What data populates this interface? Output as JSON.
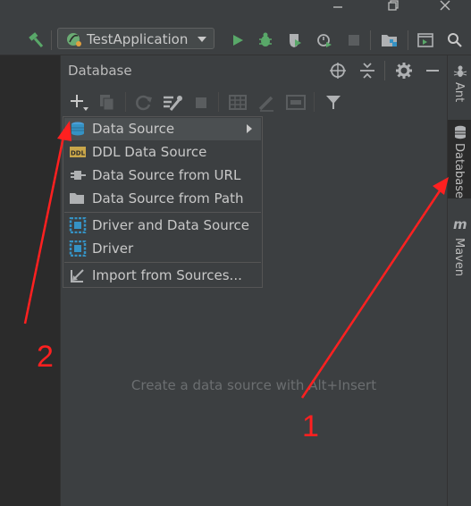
{
  "toolbar": {
    "run_config": "TestApplication",
    "icons": [
      "build-hammer-icon",
      "run-icon",
      "debug-icon",
      "coverage-icon",
      "profile-icon",
      "stop-icon",
      "project-structure-icon",
      "terminal-icon",
      "search-icon"
    ]
  },
  "db_panel": {
    "title": "Database",
    "empty_hint": "Create a data source with Alt+Insert"
  },
  "menu": {
    "items": [
      {
        "label": "Data Source",
        "icon": "database-icon",
        "has_submenu": true
      },
      {
        "label": "DDL Data Source",
        "icon": "ddl-icon"
      },
      {
        "label": "Data Source from URL",
        "icon": "url-plug-icon"
      },
      {
        "label": "Data Source from Path",
        "icon": "folder-icon"
      },
      {
        "label": "Driver and Data Source",
        "icon": "driver-icon"
      },
      {
        "label": "Driver",
        "icon": "driver-icon"
      },
      {
        "label": "Import from Sources...",
        "icon": "import-icon"
      }
    ]
  },
  "right_strip": {
    "ant": "Ant",
    "database": "Database",
    "maven": "Maven"
  },
  "annotations": {
    "one": "1",
    "two": "2"
  },
  "colors": {
    "panel_bg": "#3c3f41",
    "editor_bg": "#2b2b2b",
    "run_green": "#59a869",
    "accent_blue": "#3592c4",
    "annotation_red": "#ff2020"
  }
}
